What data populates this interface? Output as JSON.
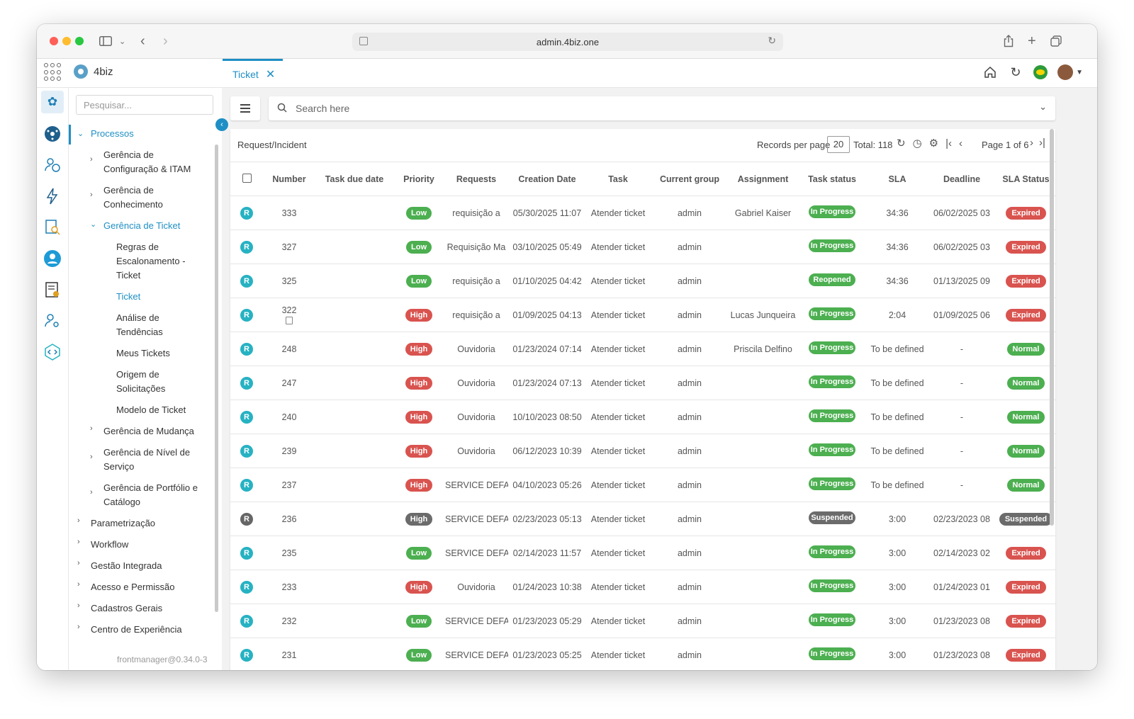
{
  "browser": {
    "url": "admin.4biz.one"
  },
  "app": {
    "name": "4biz",
    "tab_label": "Ticket"
  },
  "sidebar": {
    "search_placeholder": "Pesquisar...",
    "section": "Processos",
    "items": [
      {
        "label": "Gerência de\nConfiguração & ITAM"
      },
      {
        "label": "Gerência de\nConhecimento"
      },
      {
        "label": "Gerência de Ticket"
      },
      {
        "label": "Regras de\nEscalonamento -\nTicket"
      },
      {
        "label": "Ticket"
      },
      {
        "label": "Análise de\nTendências"
      },
      {
        "label": "Meus Tickets"
      },
      {
        "label": "Origem de\nSolicitações"
      },
      {
        "label": "Modelo de Ticket"
      },
      {
        "label": "Gerência de Mudança"
      },
      {
        "label": "Gerência de Nível de\nServiço"
      },
      {
        "label": "Gerência de Portfólio e\nCatálogo"
      },
      {
        "label": "Parametrização"
      },
      {
        "label": "Workflow"
      },
      {
        "label": "Gestão Integrada"
      },
      {
        "label": "Acesso e Permissão"
      },
      {
        "label": "Cadastros Gerais"
      },
      {
        "label": "Centro de Experiência"
      }
    ],
    "version": "frontmanager@0.34.0-3"
  },
  "search": {
    "placeholder": "Search here"
  },
  "panel": {
    "title": "Request/Incident",
    "records_per_page_label": "Records per page",
    "records_per_page": "20",
    "total": "Total: 118",
    "page_info": "Page 1 of 6"
  },
  "table": {
    "headers": [
      "Number",
      "Task due date",
      "Priority",
      "Requests",
      "Creation Date",
      "Task",
      "Current group",
      "Assignment",
      "Task status",
      "SLA",
      "Deadline",
      "SLA Status"
    ],
    "rows": [
      {
        "badge": "R",
        "number": "333",
        "priority": "Low",
        "request": "requisição a",
        "created": "05/30/2025 11:07",
        "task": "Atender ticket",
        "group": "admin",
        "assign": "Gabriel Kaiser",
        "status": "In Progress",
        "sla": "34:36",
        "deadline": "06/02/2025 03",
        "sla_status": "Expired"
      },
      {
        "badge": "R",
        "number": "327",
        "priority": "Low",
        "request": "Requisição Ma",
        "created": "03/10/2025 05:49",
        "task": "Atender ticket",
        "group": "admin",
        "assign": "",
        "status": "In Progress",
        "sla": "34:36",
        "deadline": "06/02/2025 03",
        "sla_status": "Expired"
      },
      {
        "badge": "R",
        "number": "325",
        "priority": "Low",
        "request": "requisição a",
        "created": "01/10/2025 04:42",
        "task": "Atender ticket",
        "group": "admin",
        "assign": "",
        "status": "Reopened",
        "sla": "34:36",
        "deadline": "01/13/2025 09",
        "sla_status": "Expired"
      },
      {
        "badge": "R",
        "number": "322",
        "priority": "High",
        "request": "requisição a",
        "created": "01/09/2025 04:13",
        "task": "Atender ticket",
        "group": "admin",
        "assign": "Lucas Junqueira",
        "status": "In Progress",
        "sla": "2:04",
        "deadline": "01/09/2025 06",
        "sla_status": "Expired"
      },
      {
        "badge": "R",
        "number": "248",
        "priority": "High",
        "request": "Ouvidoria",
        "created": "01/23/2024 07:14",
        "task": "Atender ticket",
        "group": "admin",
        "assign": "Priscila Delfino",
        "status": "In Progress",
        "sla": "To be defined",
        "deadline": "-",
        "sla_status": "Normal"
      },
      {
        "badge": "R",
        "number": "247",
        "priority": "High",
        "request": "Ouvidoria",
        "created": "01/23/2024 07:13",
        "task": "Atender ticket",
        "group": "admin",
        "assign": "",
        "status": "In Progress",
        "sla": "To be defined",
        "deadline": "-",
        "sla_status": "Normal"
      },
      {
        "badge": "R",
        "number": "240",
        "priority": "High",
        "request": "Ouvidoria",
        "created": "10/10/2023 08:50",
        "task": "Atender ticket",
        "group": "admin",
        "assign": "",
        "status": "In Progress",
        "sla": "To be defined",
        "deadline": "-",
        "sla_status": "Normal"
      },
      {
        "badge": "R",
        "number": "239",
        "priority": "High",
        "request": "Ouvidoria",
        "created": "06/12/2023 10:39",
        "task": "Atender ticket",
        "group": "admin",
        "assign": "",
        "status": "In Progress",
        "sla": "To be defined",
        "deadline": "-",
        "sla_status": "Normal"
      },
      {
        "badge": "R",
        "number": "237",
        "priority": "High",
        "request": "SERVICE DEFA",
        "created": "04/10/2023 05:26",
        "task": "Atender ticket",
        "group": "admin",
        "assign": "",
        "status": "In Progress",
        "sla": "To be defined",
        "deadline": "-",
        "sla_status": "Normal"
      },
      {
        "badge": "R",
        "number": "236",
        "priority": "High",
        "request": "SERVICE DEFA",
        "created": "02/23/2023 05:13",
        "task": "Atender ticket",
        "group": "admin",
        "assign": "",
        "status": "Suspended",
        "sla": "3:00",
        "deadline": "02/23/2023 08",
        "sla_status": "Suspended"
      },
      {
        "badge": "R",
        "number": "235",
        "priority": "Low",
        "request": "SERVICE DEFA",
        "created": "02/14/2023 11:57",
        "task": "Atender ticket",
        "group": "admin",
        "assign": "",
        "status": "In Progress",
        "sla": "3:00",
        "deadline": "02/14/2023 02",
        "sla_status": "Expired"
      },
      {
        "badge": "R",
        "number": "233",
        "priority": "High",
        "request": "Ouvidoria",
        "created": "01/24/2023 10:38",
        "task": "Atender ticket",
        "group": "admin",
        "assign": "",
        "status": "In Progress",
        "sla": "3:00",
        "deadline": "01/24/2023 01",
        "sla_status": "Expired"
      },
      {
        "badge": "R",
        "number": "232",
        "priority": "Low",
        "request": "SERVICE DEFA",
        "created": "01/23/2023 05:29",
        "task": "Atender ticket",
        "group": "admin",
        "assign": "",
        "status": "In Progress",
        "sla": "3:00",
        "deadline": "01/23/2023 08",
        "sla_status": "Expired"
      },
      {
        "badge": "R",
        "number": "231",
        "priority": "Low",
        "request": "SERVICE DEFA",
        "created": "01/23/2023 05:25",
        "task": "Atender ticket",
        "group": "admin",
        "assign": "",
        "status": "In Progress",
        "sla": "3:00",
        "deadline": "01/23/2023 08",
        "sla_status": "Expired"
      }
    ]
  },
  "colors": {
    "accent": "#1e8fc5",
    "success": "#4caf50",
    "danger": "#d9534f",
    "muted": "#6b6b6b"
  }
}
